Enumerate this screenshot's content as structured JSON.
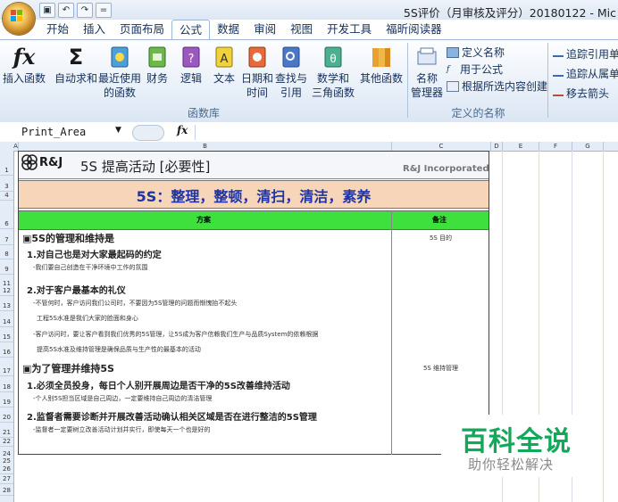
{
  "window": {
    "title": "5S评价（月审核及评分）20180122 - Mic"
  },
  "quick_access": {
    "save_icon": "save-icon",
    "undo_icon": "undo-icon",
    "redo_icon": "redo-icon",
    "more": "="
  },
  "tabs": [
    "开始",
    "插入",
    "页面布局",
    "公式",
    "数据",
    "审阅",
    "视图",
    "开发工具",
    "福昕阅读器"
  ],
  "active_tab": "公式",
  "ribbon": {
    "function_library": {
      "label": "函数库",
      "insert_function": "插入函数",
      "autosum": "自动求和",
      "recent_1": "最近使用",
      "recent_2": "的函数",
      "financial": "财务",
      "logical": "逻辑",
      "text": "文本",
      "datetime_1": "日期和",
      "datetime_2": "时间",
      "lookup_1": "查找与",
      "lookup_2": "引用",
      "math_1": "数学和",
      "math_2": "三角函数",
      "more_1": "其他函数"
    },
    "defined_names": {
      "label": "定义的名称",
      "name_manager_1": "名称",
      "name_manager_2": "管理器",
      "define_name": "定义名称",
      "use_in_formula": "用于公式",
      "create_from_selection": "根据所选内容创建"
    },
    "auditing": {
      "trace_precedents": "追踪引用单",
      "trace_dependents": "追踪从属单",
      "remove_arrows": "移去箭头"
    }
  },
  "formula_bar": {
    "name_box": "Print_Area",
    "fx": "fx"
  },
  "columns": [
    "A",
    "B",
    "C",
    "D",
    "E",
    "F",
    "G"
  ],
  "rows": [
    "1",
    "3",
    "4",
    "6",
    "7",
    "8",
    "9",
    "11",
    "12",
    "13",
    "14",
    "15",
    "16",
    "17",
    "18",
    "19",
    "20",
    "21",
    "22",
    "24",
    "25",
    "26",
    "27",
    "28"
  ],
  "sheet": {
    "logo_text": "R&J",
    "title": "5S 提高活动 [必要性]",
    "company": "R&J Incorporated",
    "banner": "5S：整理，整顿，清扫，清洁，素养",
    "col_plan": "方案",
    "col_note": "备注",
    "sections": [
      {
        "heading": "▣5S的管理和维持是",
        "note": "5S 目的"
      },
      {
        "heading": "▣为了管理并维持5S",
        "note": "5S 维持管理"
      }
    ],
    "lines": [
      "1.对自己也是对大家最起码的约定",
      "-我们要自己创造在干净环境中工作的氛围",
      "2.对于客户最基本的礼仪",
      "-不管何时，客户访问我们公司时，不要因为5S管理的问题而惭愧抬不起头",
      "工程5S水准是我们大家的脸面和身心",
      "-客户访问时，要让客户看到我们优秀的5S管理，让5S成为客户信赖我们生产与品质System的依赖根据",
      "提高5S水准及维持管理是确保品质与生产性的最基本的活动",
      "1.必须全员投身，每日个人别开展周边是否干净的5S改善维持活动",
      "-个人别5S担当区域是自己周边，一定要维持自己周边的清洁管理",
      "2.监督者需要诊断并开展改善活动确认相关区域是否在进行整洁的5S管理",
      "-监督者一定要树立改善活动计划并实行，即使每天一个也是好的"
    ]
  },
  "watermark": {
    "big": "百科全说",
    "small": "助你轻松解决"
  },
  "colors": {
    "accent": "#1d33a8",
    "banner": "#f6d5b8",
    "green": "#3ee03e",
    "watermark": "#12a85a"
  }
}
